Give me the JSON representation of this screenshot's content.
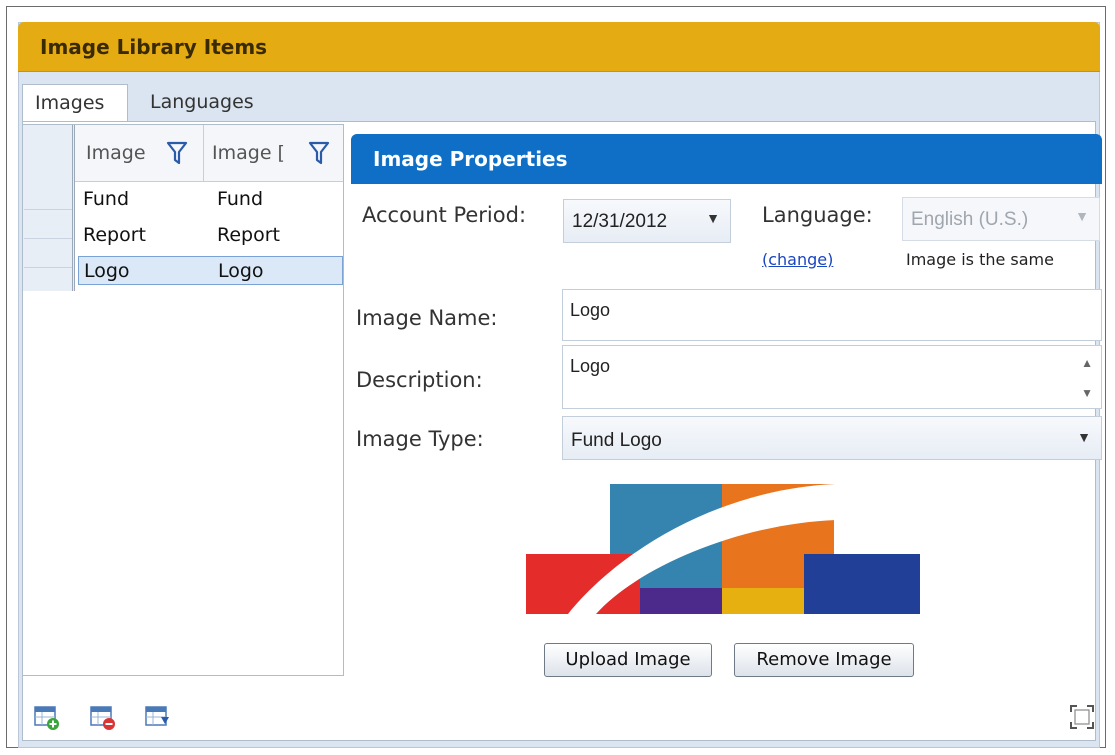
{
  "panel": {
    "title": "Image Library Items"
  },
  "tabs": [
    {
      "label": "Images"
    },
    {
      "label": "Languages"
    }
  ],
  "grid": {
    "columns": [
      {
        "label": "Image"
      },
      {
        "label": "Image ["
      }
    ],
    "rows": [
      {
        "c1": "Fund",
        "c2": "Fund"
      },
      {
        "c1": "Report",
        "c2": "Report"
      },
      {
        "c1": "Logo",
        "c2": "Logo",
        "selected": true
      }
    ]
  },
  "properties": {
    "title": "Image Properties",
    "account_period_label": "Account Period:",
    "account_period_value": "12/31/2012",
    "language_label": "Language:",
    "language_value": "English (U.S.)",
    "change_link": "(change)",
    "same_note": "Image is the same",
    "image_name_label": "Image Name:",
    "image_name_value": "Logo",
    "description_label": "Description:",
    "description_value": "Logo",
    "image_type_label": "Image Type:",
    "image_type_value": "Fund Logo",
    "upload_button": "Upload Image",
    "remove_button": "Remove Image"
  },
  "icons": {
    "add_row": "add-row-icon",
    "delete_row": "delete-row-icon",
    "export": "export-icon",
    "maximize": "maximize-icon"
  },
  "colors": {
    "title_bar": "#e5ab12",
    "props_header": "#0f6fc6",
    "link": "#1a46c0"
  }
}
